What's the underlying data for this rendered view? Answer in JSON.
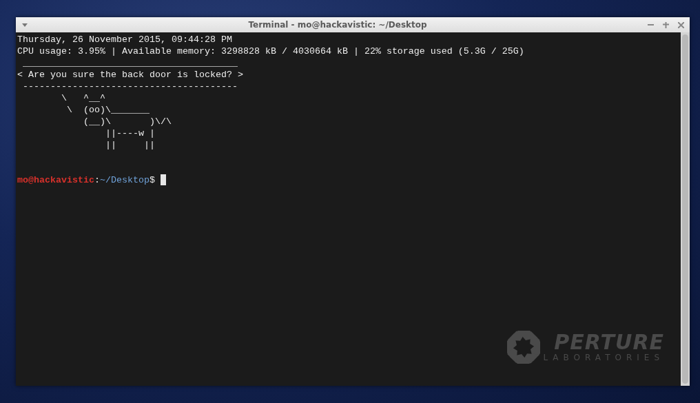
{
  "window": {
    "title": "Terminal - mo@hackavistic: ~/Desktop"
  },
  "output_lines": [
    "Thursday, 26 November 2015, 09:44:28 PM",
    "CPU usage: 3.95% | Available memory: 3298828 kB / 4030664 kB | 22% storage used (5.3G / 25G)",
    " _______________________________________",
    "< Are you sure the back door is locked? >",
    " ---------------------------------------",
    "        \\   ^__^",
    "         \\  (oo)\\_______",
    "            (__)\\       )\\/\\",
    "                ||----w |",
    "                ||     ||"
  ],
  "prompt": {
    "user_host": "mo@hackavistic",
    "separator": ":",
    "path": "~/Desktop",
    "symbol": "$"
  },
  "background_logo": {
    "word": "PERTURE",
    "subtitle": "LABORATORIES"
  }
}
